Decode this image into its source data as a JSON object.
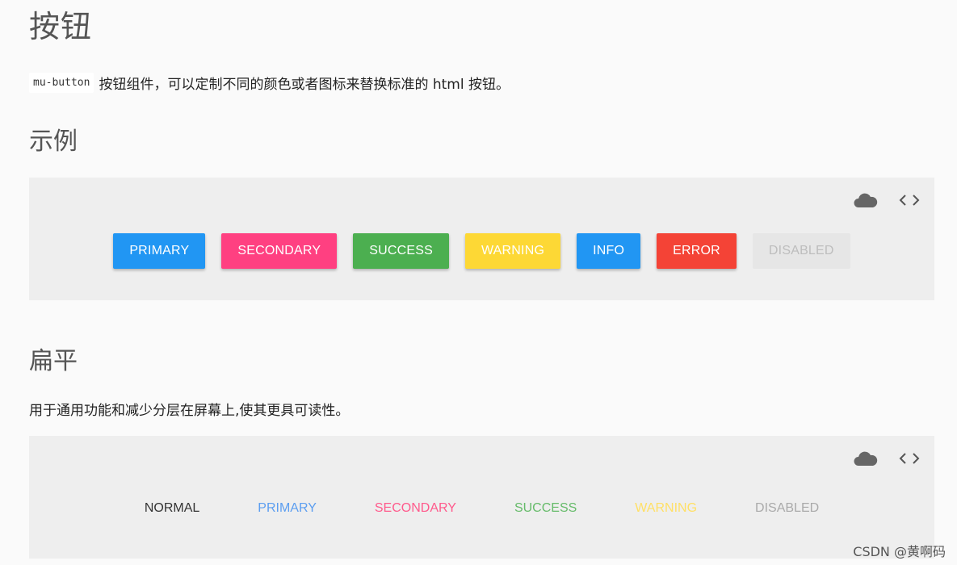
{
  "page": {
    "title": "按钮",
    "intro_code": "mu-button",
    "intro_text": "按钮组件，可以定制不同的颜色或者图标来替换标准的 html 按钮。"
  },
  "example": {
    "title": "示例",
    "tools": {
      "cloud_icon": "cloud-icon",
      "code_icon": "code-icon"
    },
    "buttons": [
      {
        "label": "PRIMARY",
        "color": "#2196f3",
        "text_color": "#ffffff"
      },
      {
        "label": "SECONDARY",
        "color": "#ff4081",
        "text_color": "#ffffff"
      },
      {
        "label": "SUCCESS",
        "color": "#4caf50",
        "text_color": "#ffffff"
      },
      {
        "label": "WARNING",
        "color": "#fdd835",
        "text_color": "#ffffff"
      },
      {
        "label": "INFO",
        "color": "#2196f3",
        "text_color": "#ffffff"
      },
      {
        "label": "ERROR",
        "color": "#f44336",
        "text_color": "#ffffff"
      },
      {
        "label": "DISABLED",
        "color": "#e6e6e6",
        "text_color": "#bdbdbd",
        "disabled": true
      }
    ]
  },
  "flat": {
    "title": "扁平",
    "description": "用于通用功能和减少分层在屏幕上,使其更具可读性。",
    "tools": {
      "cloud_icon": "cloud-icon",
      "code_icon": "code-icon"
    },
    "buttons": [
      {
        "label": "NORMAL",
        "color": "#333333"
      },
      {
        "label": "PRIMARY",
        "color": "#5c9ef0"
      },
      {
        "label": "SECONDARY",
        "color": "#ff5a8c"
      },
      {
        "label": "SUCCESS",
        "color": "#66bb6a"
      },
      {
        "label": "WARNING",
        "color": "#ffe066"
      },
      {
        "label": "DISABLED",
        "color": "#aaaaaa",
        "disabled": true
      }
    ]
  },
  "watermark": "CSDN @黄啊码"
}
